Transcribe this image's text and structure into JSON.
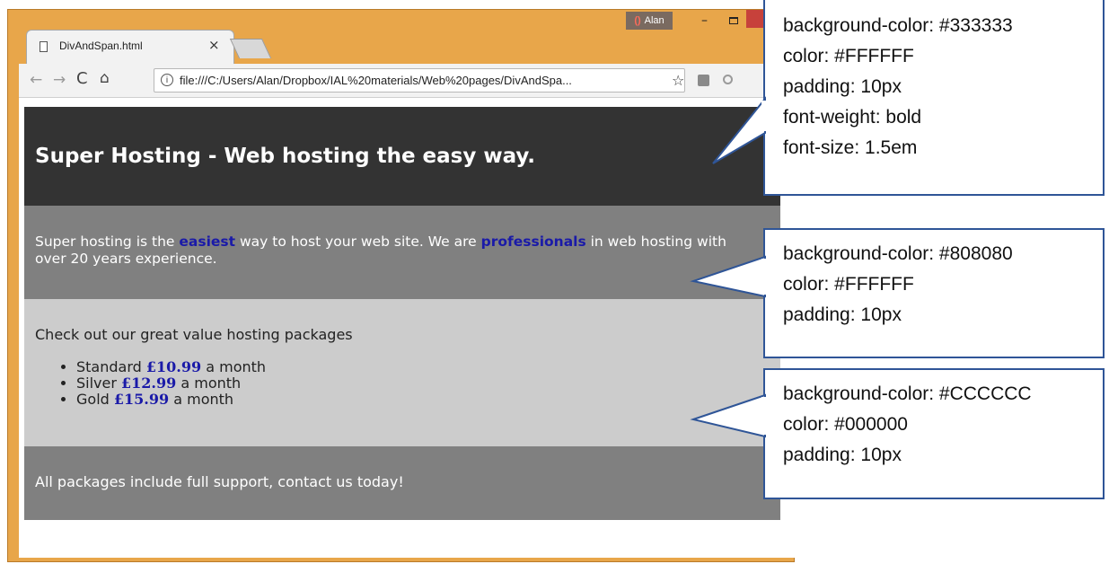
{
  "browser": {
    "tab_title": "DivAndSpan.html",
    "tab_close": "×",
    "profile_name": "Alan",
    "url": "file:///C:/Users/Alan/Dropbox/IAL%20materials/Web%20pages/DivAndSpa...",
    "icons": [
      "page-icon",
      "back-icon",
      "forward-icon",
      "reload-icon",
      "home-icon",
      "info-icon",
      "star-icon",
      "extension-icon",
      "extension-icon",
      "menu-icon"
    ]
  },
  "page": {
    "header_title": "Super Hosting - Web hosting the easy way.",
    "intro_part1": "Super hosting is the ",
    "intro_easiest": "easiest",
    "intro_part2": " way to host your web site. We are ",
    "intro_professionals": "professionals",
    "intro_part3": " in web hosting with over 20 years experience.",
    "packages_lead": "Check out our great value hosting packages",
    "packages": [
      {
        "name": "Standard",
        "price": "£10.99",
        "suffix": "a month"
      },
      {
        "name": "Silver",
        "price": "£12.99",
        "suffix": "a month"
      },
      {
        "name": "Gold",
        "price": "£15.99",
        "suffix": "a month"
      }
    ],
    "footer_text": "All packages include full support, contact us today!",
    "colors": {
      "header_bg": "#333333",
      "intro_bg": "#808080",
      "packages_bg": "#CCCCCC",
      "highlight": "#1a1aa8"
    }
  },
  "callouts": [
    {
      "lines": [
        "background-color: #333333",
        "color: #FFFFFF",
        "padding: 10px",
        "font-weight: bold",
        "font-size: 1.5em"
      ]
    },
    {
      "lines": [
        "background-color: #808080",
        "color: #FFFFFF",
        "padding: 10px"
      ]
    },
    {
      "lines": [
        "background-color: #CCCCCC",
        "color: #000000",
        "padding: 10px"
      ]
    }
  ]
}
